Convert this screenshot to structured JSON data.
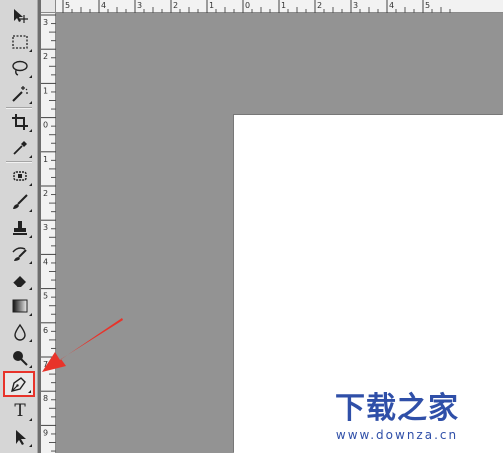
{
  "ruler_top": {
    "labels": [
      "5",
      "4",
      "3",
      "2",
      "1",
      "0",
      "1",
      "2",
      "3",
      "4",
      "5"
    ]
  },
  "ruler_left": {
    "labels": [
      "3",
      "2",
      "1",
      "0",
      "1",
      "2",
      "3",
      "4",
      "5",
      "6",
      "7",
      "8",
      "9"
    ]
  },
  "toolbox": {
    "type_tool_glyph": "T",
    "tools": [
      "move-icon",
      "marquee-icon",
      "lasso-icon",
      "magic-wand-icon",
      "crop-icon",
      "eyedropper-icon",
      "healing-brush-icon",
      "brush-icon",
      "clone-stamp-icon",
      "history-brush-icon",
      "eraser-icon",
      "gradient-icon",
      "blur-icon",
      "dodge-icon",
      "pen-icon",
      "type-icon",
      "path-selection-icon"
    ],
    "selected_tool": "pen-icon"
  },
  "watermark": {
    "title": "下载之家",
    "url": "www.downza.cn"
  },
  "colors": {
    "workspace": "#939393",
    "canvas": "#ffffff",
    "highlight": "#e8332a",
    "watermark": "#2f4fa8"
  }
}
